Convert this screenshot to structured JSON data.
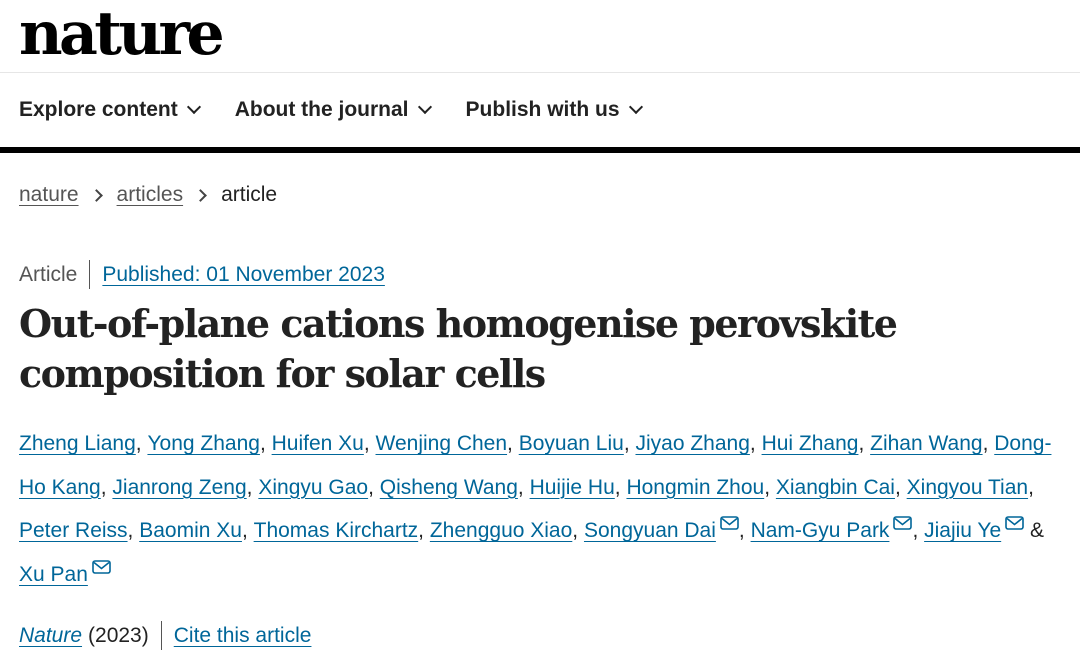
{
  "site": {
    "logo": "nature"
  },
  "nav": {
    "items": [
      {
        "label": "Explore content"
      },
      {
        "label": "About the journal"
      },
      {
        "label": "Publish with us"
      }
    ]
  },
  "breadcrumb": {
    "items": [
      "nature",
      "articles",
      "article"
    ]
  },
  "article": {
    "type": "Article",
    "published": "Published: 01 November 2023",
    "title_line1": "Out-of-plane cations homogenise perovskite",
    "title_line2": "composition for solar cells",
    "authors": [
      {
        "name": "Zheng Liang",
        "email": false
      },
      {
        "name": "Yong Zhang",
        "email": false
      },
      {
        "name": "Huifen Xu",
        "email": false
      },
      {
        "name": "Wenjing Chen",
        "email": false
      },
      {
        "name": "Boyuan Liu",
        "email": false
      },
      {
        "name": "Jiyao Zhang",
        "email": false
      },
      {
        "name": "Hui Zhang",
        "email": false
      },
      {
        "name": "Zihan Wang",
        "email": false
      },
      {
        "name": "Dong-Ho Kang",
        "email": false
      },
      {
        "name": "Jianrong Zeng",
        "email": false
      },
      {
        "name": "Xingyu Gao",
        "email": false
      },
      {
        "name": "Qisheng Wang",
        "email": false
      },
      {
        "name": "Huijie Hu",
        "email": false
      },
      {
        "name": "Hongmin Zhou",
        "email": false
      },
      {
        "name": "Xiangbin Cai",
        "email": false
      },
      {
        "name": "Xingyou Tian",
        "email": false
      },
      {
        "name": "Peter Reiss",
        "email": false
      },
      {
        "name": "Baomin Xu",
        "email": false
      },
      {
        "name": "Thomas Kirchartz",
        "email": false
      },
      {
        "name": "Zhengguo Xiao",
        "email": false
      },
      {
        "name": "Songyuan Dai",
        "email": true
      },
      {
        "name": "Nam-Gyu Park",
        "email": true
      },
      {
        "name": "Jiajiu Ye",
        "email": true
      },
      {
        "name": "Xu Pan",
        "email": true
      }
    ],
    "author_separator": ", ",
    "author_last_separator": " & ",
    "journal": "Nature",
    "year": "(2023)",
    "cite_label": "Cite this article"
  },
  "icons": {
    "nav_chevron": "chevron-down-icon",
    "breadcrumb_separator": "chevron-right-icon",
    "author_email": "envelope-icon"
  },
  "colors": {
    "link": "#006699",
    "text": "#222222",
    "muted": "#555555",
    "nav_rule": "#000000"
  }
}
